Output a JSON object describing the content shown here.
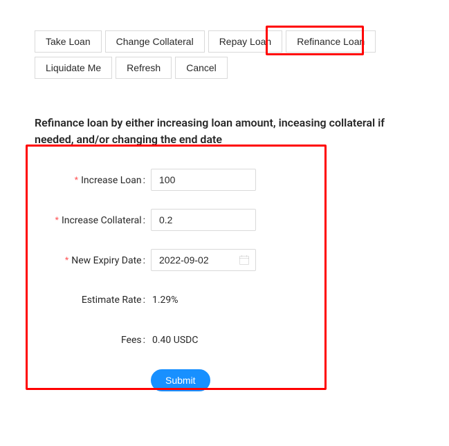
{
  "tabs": {
    "take_loan": "Take Loan",
    "change_collateral": "Change Collateral",
    "repay_loan": "Repay Loan",
    "refinance_loan": "Refinance Loan",
    "liquidate_me": "Liquidate Me",
    "refresh": "Refresh",
    "cancel": "Cancel"
  },
  "section_title": "Refinance loan by either increasing loan amount, inceasing collateral if needed, and/or changing the end date",
  "form": {
    "increase_loan": {
      "label": "Increase Loan",
      "value": "100"
    },
    "increase_collateral": {
      "label": "Increase Collateral",
      "value": "0.2"
    },
    "new_expiry": {
      "label": "New Expiry Date",
      "value": "2022-09-02"
    },
    "estimate_rate": {
      "label": "Estimate Rate",
      "value": "1.29%"
    },
    "fees": {
      "label": "Fees",
      "value": "0.40 USDC"
    },
    "submit": "Submit"
  }
}
